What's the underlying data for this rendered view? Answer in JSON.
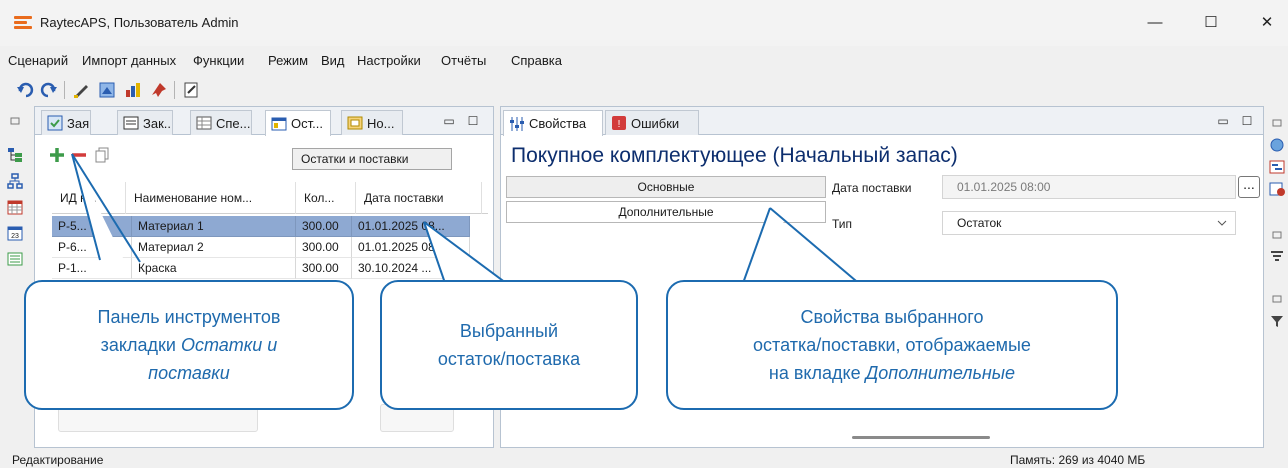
{
  "window": {
    "title": "RaytecAPS, Пользователь Admin",
    "minimize": "—",
    "maximize": "☐",
    "close": "✕"
  },
  "menu": [
    "Сценарий",
    "Импорт данных",
    "Функции",
    "Режим",
    "Вид",
    "Настройки",
    "Отчёты",
    "Справка"
  ],
  "left_panel": {
    "tabs": [
      "Зая...",
      "Зак...",
      "Спе...",
      "Ост...",
      "Но..."
    ],
    "active_tab_index": 3,
    "tooltip": "Остатки и поставки",
    "columns": [
      "ИД н...",
      "Наименование ном...",
      "Кол...",
      "Дата поставки"
    ],
    "rows": [
      [
        "Р-5...",
        "Материал 1",
        "300.00",
        "01.01.2025 08..."
      ],
      [
        "Р-6...",
        "Материал 2",
        "300.00",
        "01.01.2025 08..."
      ],
      [
        "Р-1...",
        "Краска",
        "300.00",
        "30.10.2024 ..."
      ]
    ],
    "selected_row_index": 0
  },
  "right_panel": {
    "tabs": [
      "Свойства",
      "Ошибки"
    ],
    "title": "Покупное комплектующее (Начальный запас)",
    "category_buttons": [
      "Основные",
      "Дополнительные"
    ],
    "properties": [
      {
        "label": "Дата поставки",
        "value": "01.01.2025 08:00"
      },
      {
        "label": "Тип",
        "value": "Остаток"
      }
    ],
    "ellipsis": "..."
  },
  "callouts": {
    "toolbar_line1": "Панель инструментов",
    "toolbar_line2a": "закладки ",
    "toolbar_line2b": "Остатки и",
    "toolbar_line3": "поставки",
    "selected_line1": "Выбранный",
    "selected_line2": "остаток/поставка",
    "props_line1": "Свойства выбранного",
    "props_line2": "остатка/поставки, отображаемые",
    "props_line3a": "на вкладке ",
    "props_line3b": "Дополнительные"
  },
  "status": {
    "left": "Редактирование",
    "right": "Память: 269 из 4040 МБ"
  },
  "colors": {
    "accent": "#1c6bb0",
    "selection": "#8ea9d2",
    "title_blue": "#0d2e6e",
    "logo": "#e96b1c"
  }
}
